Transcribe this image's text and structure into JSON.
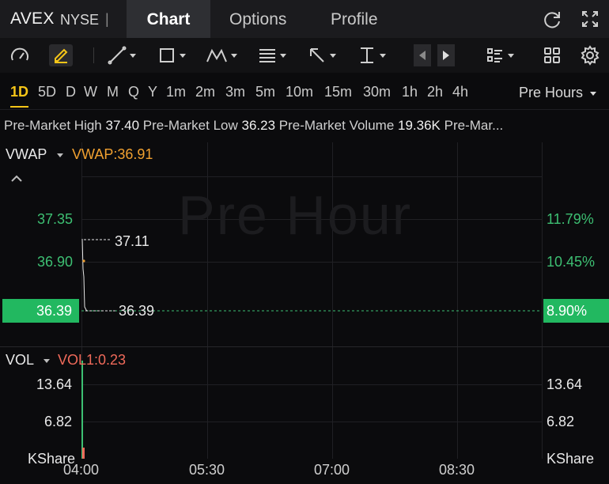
{
  "header": {
    "ticker": "AVEX",
    "exchange": "NYSE",
    "separator": "|",
    "tabs": [
      {
        "label": "Chart",
        "active": true
      },
      {
        "label": "Options",
        "active": false
      },
      {
        "label": "Profile",
        "active": false
      }
    ],
    "icons": [
      "refresh-icon",
      "fullscreen-icon"
    ]
  },
  "toolbar": {
    "tools": [
      "indicator-gauge-icon",
      "draw-pencil-icon",
      "trendline-icon",
      "rectangle-icon",
      "pattern-icon",
      "fibonacci-icon",
      "arrow-icon",
      "measure-icon",
      "scroll-left-icon",
      "scroll-right-icon",
      "layout-list-icon",
      "grid-icon",
      "settings-icon"
    ]
  },
  "intervals": {
    "items": [
      "1D",
      "5D",
      "D",
      "W",
      "M",
      "Q",
      "Y",
      "1m",
      "2m",
      "3m",
      "5m",
      "10m",
      "15m",
      "30m",
      "1h",
      "2h",
      "4h"
    ],
    "active": "1D",
    "session": "Pre Hours"
  },
  "stats": {
    "high_label": "Pre-Market High",
    "high_value": "37.40",
    "low_label": "Pre-Market Low",
    "low_value": "36.23",
    "volume_label": "Pre-Market Volume",
    "volume_value": "19.36K",
    "more": "Pre-Mar..."
  },
  "price_panel": {
    "indicator": "VWAP",
    "indicator_value": "VWAP:36.91",
    "watermark": "Pre Hour",
    "y_ticks_left": [
      "37.35",
      "36.90"
    ],
    "y_ticks_right": [
      "11.79%",
      "10.45%"
    ],
    "current_price": "36.39",
    "current_pct": "8.90%",
    "high_marker": "37.11",
    "last_marker": "36.39"
  },
  "volume_panel": {
    "indicator": "VOL",
    "indicator_value": "VOL1:0.23",
    "y_ticks_left": [
      "13.64",
      "6.82",
      "KShare"
    ],
    "y_ticks_right": [
      "13.64",
      "6.82",
      "KShare"
    ]
  },
  "x_axis": [
    "04:00",
    "05:30",
    "07:00",
    "08:30"
  ],
  "colors": {
    "up": "#3dbf72",
    "vwap": "#f0a030",
    "vol": "#f06a5a",
    "accent": "#f5c518"
  }
}
